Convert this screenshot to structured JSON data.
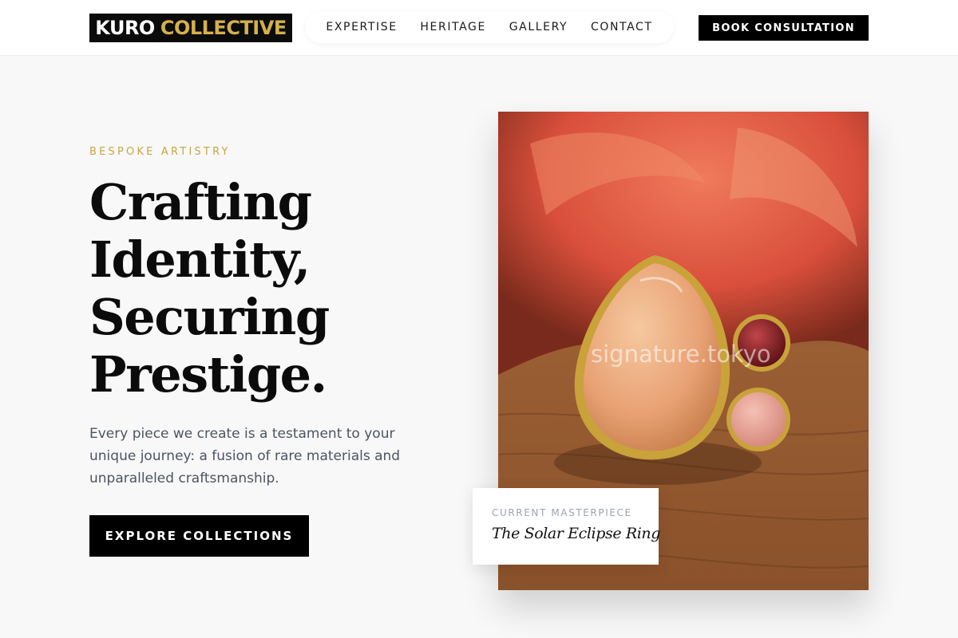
{
  "brand": {
    "name_primary": "KURO",
    "name_accent": "COLLECTIVE",
    "accent_color": "#d4b04c"
  },
  "nav": {
    "items": [
      "EXPERTISE",
      "HERITAGE",
      "GALLERY",
      "CONTACT"
    ]
  },
  "header": {
    "book_label": "BOOK CONSULTATION"
  },
  "hero": {
    "eyebrow": "BESPOKE ARTISTRY",
    "headline_lines": [
      "Crafting",
      "Identity,",
      "Securing",
      "Prestige."
    ],
    "description_lines": [
      "Every piece we create is a testament to your",
      "unique journey: a fusion of rare materials and",
      "unparalleled craftsmanship."
    ],
    "cta_label": "EXPLORE COLLECTIONS"
  },
  "feature": {
    "image_icon": "ring-photo",
    "watermark": "signature.tokyo",
    "caption_label": "CURRENT MASTERPIECE",
    "caption_title": "The Solar Eclipse Ring"
  }
}
